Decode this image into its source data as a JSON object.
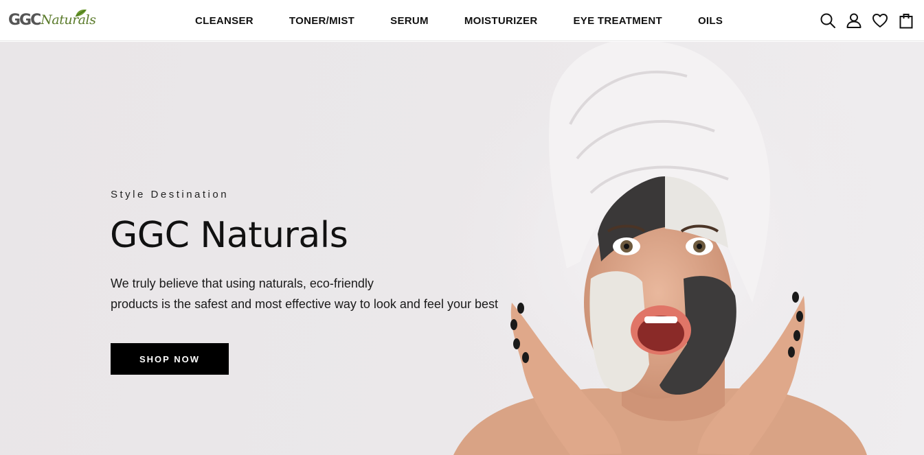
{
  "brand": {
    "logo_ggc": "GGC",
    "logo_naturals": "Naturals",
    "brand_color": "#5a7a2a"
  },
  "nav": {
    "items": [
      {
        "label": "CLEANSER"
      },
      {
        "label": "TONER/MIST"
      },
      {
        "label": "SERUM"
      },
      {
        "label": "MOISTURIZER"
      },
      {
        "label": "EYE TREATMENT"
      },
      {
        "label": "OILS"
      }
    ]
  },
  "header_icons": [
    "search-icon",
    "account-icon",
    "wishlist-heart-icon",
    "cart-bag-icon"
  ],
  "hero": {
    "eyebrow": "Style Destination",
    "title": "GGC Naturals",
    "description_line1": "We truly believe that using naturals, eco-friendly",
    "description_line2": "products is the safest and most effective way to look and feel your best",
    "cta_label": "SHOP NOW",
    "background_color": "#ebe8ea",
    "cta_color": "#000000"
  }
}
